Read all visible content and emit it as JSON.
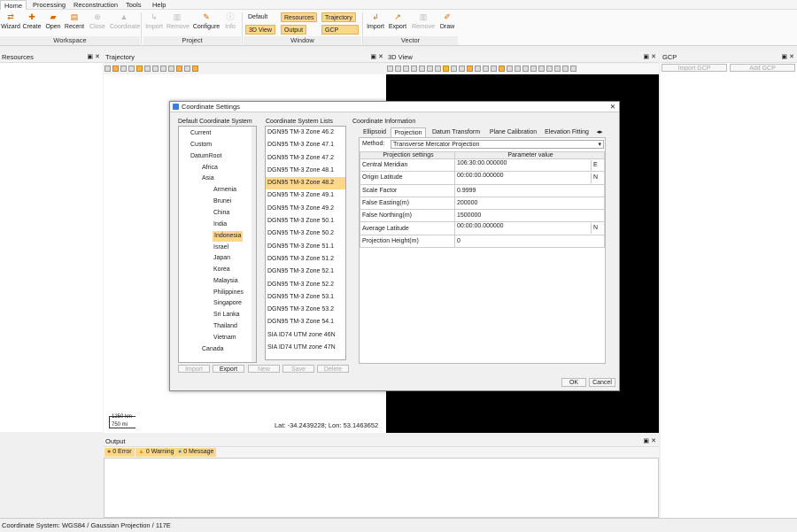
{
  "menu": [
    "Home",
    "Processing",
    "Reconstruction",
    "Tools",
    "Help"
  ],
  "ribbon": {
    "workspace": {
      "label": "Workspace",
      "buttons": [
        "Wizard",
        "Create",
        "Open",
        "Recent",
        "Close",
        "Coordinate"
      ]
    },
    "project": {
      "label": "Project",
      "buttons": [
        "Import",
        "Remove",
        "Configure",
        "Info"
      ]
    },
    "window": {
      "label": "Window",
      "buttons": [
        "Default",
        "Resources",
        "Trajectory",
        "3D View",
        "Output",
        "GCP"
      ]
    },
    "vector": {
      "label": "Vector",
      "buttons": [
        "Import",
        "Export",
        "Remove",
        "Draw"
      ]
    }
  },
  "panels": {
    "resources": "Resources",
    "trajectory": "Trajectory",
    "view3d": "3D View",
    "gcp": "GCP",
    "output": "Output"
  },
  "gcp": {
    "import": "Import GCP",
    "add": "Add GCP"
  },
  "scale": {
    "km": "1250 km",
    "mi": "750 mi"
  },
  "coords": "Lat: -34.2439228; Lon: 53.1463652",
  "output": {
    "error": "0 Error",
    "warning": "0 Warning",
    "message": "0 Message"
  },
  "dialog": {
    "title": "Coordinate Settings",
    "h_default": "Default Coordinate System",
    "h_lists": "Coordinate System Lists",
    "h_info": "Coordinate Information",
    "tree": [
      "Current",
      "Custom",
      "DatumRoot",
      "Africa",
      "Asia",
      "Armenia",
      "Brunei",
      "China",
      "India",
      "Indonesia",
      "Israel",
      "Japan",
      "Korea",
      "Malaysia",
      "Philippines",
      "Singapore",
      "Sri Lanka",
      "Thailand",
      "Vietnam",
      "Canada"
    ],
    "list": [
      "DGN95 TM-3 Zone 46.2",
      "DGN95 TM-3 Zone 47.1",
      "DGN95 TM-3 Zone 47.2",
      "DGN95 TM-3 Zone 48.1",
      "DGN95 TM-3 Zone 48.2",
      "DGN95 TM-3 Zone 49.1",
      "DGN95 TM-3 Zone 49.2",
      "DGN95 TM-3 Zone 50.1",
      "DGN95 TM-3 Zone 50.2",
      "DGN95 TM-3 Zone 51.1",
      "DGN95 TM-3 Zone 51.2",
      "DGN95 TM-3 Zone 52.1",
      "DGN95 TM-3 Zone 52.2",
      "DGN95 TM-3 Zone 53.1",
      "DGN95 TM-3 Zone 53.2",
      "DGN95 TM-3 Zone 54.1",
      "SIA ID74 UTM zone 46N",
      "SIA ID74 UTM zone 47N"
    ],
    "tabs": [
      "Ellipsoid",
      "Projection",
      "Datum Transform",
      "Plane Calibration",
      "Elevation Fitting"
    ],
    "method_label": "Method:",
    "method_value": "Transverse Mercator Projection",
    "col_settings": "Projection settings",
    "col_value": "Parameter value",
    "rows": [
      {
        "name": "Central Meridian",
        "value": "106:30:00.000000",
        "unit": "E"
      },
      {
        "name": "Origin Latitude",
        "value": "00:00:00.000000",
        "unit": "N"
      },
      {
        "name": "Scale Factor",
        "value": "0.9999",
        "unit": ""
      },
      {
        "name": "False Easting(m)",
        "value": "200000",
        "unit": ""
      },
      {
        "name": "False Northing(m)",
        "value": "1500000",
        "unit": ""
      },
      {
        "name": "Average Latitude",
        "value": "00:00:00.000000",
        "unit": "N"
      },
      {
        "name": "Projection Height(m)",
        "value": "0",
        "unit": ""
      }
    ],
    "buttons": [
      "Import",
      "Export",
      "New",
      "Save",
      "Delete"
    ],
    "ok": "OK",
    "cancel": "Cancel"
  },
  "status": "Coordinate System: WGS84 / Gaussian Projection / 117E"
}
